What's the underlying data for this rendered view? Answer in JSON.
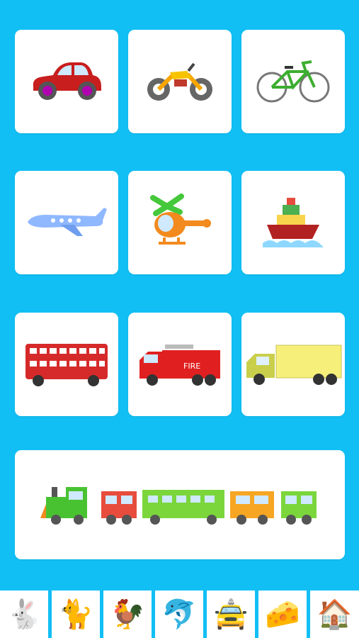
{
  "colors": {
    "background": "#11bff5",
    "card": "#ffffff"
  },
  "cards": [
    {
      "name": "car",
      "icon": "car-icon"
    },
    {
      "name": "motorcycle",
      "icon": "motorcycle-icon"
    },
    {
      "name": "bicycle",
      "icon": "bicycle-icon"
    },
    {
      "name": "airplane",
      "icon": "airplane-icon"
    },
    {
      "name": "helicopter",
      "icon": "helicopter-icon"
    },
    {
      "name": "boat",
      "icon": "boat-icon"
    },
    {
      "name": "double-decker-bus",
      "icon": "bus-icon"
    },
    {
      "name": "fire-truck",
      "icon": "fire-truck-icon",
      "label": "FIRE"
    },
    {
      "name": "truck",
      "icon": "truck-icon"
    },
    {
      "name": "train",
      "icon": "train-icon"
    }
  ],
  "tabs": [
    {
      "name": "rabbit",
      "icon": "rabbit-icon",
      "glyph": "🐇"
    },
    {
      "name": "cat",
      "icon": "cat-icon",
      "glyph": "🐈"
    },
    {
      "name": "rooster",
      "icon": "rooster-icon",
      "glyph": "🐓"
    },
    {
      "name": "dolphin",
      "icon": "dolphin-icon",
      "glyph": "🐬"
    },
    {
      "name": "taxi",
      "icon": "taxi-icon",
      "glyph": "🚖"
    },
    {
      "name": "cheese",
      "icon": "cheese-icon",
      "glyph": "🧀"
    },
    {
      "name": "house",
      "icon": "house-icon",
      "glyph": "🏠"
    }
  ]
}
